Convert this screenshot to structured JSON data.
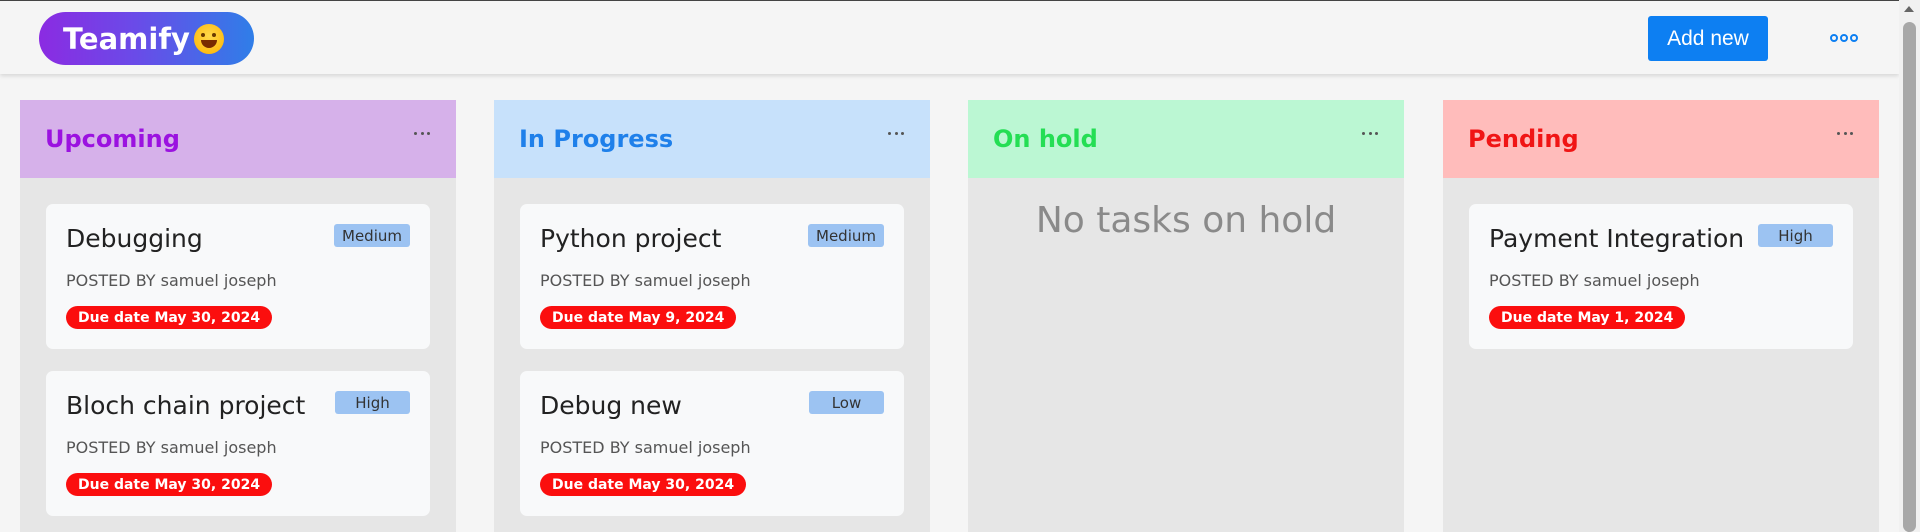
{
  "app": {
    "logo_text": "Teamify",
    "add_new_label": "Add new"
  },
  "colors": {
    "accent": "#0d7ff2",
    "upcoming": "#9b12e0",
    "in_progress": "#1f80ea",
    "on_hold": "#24de54",
    "pending": "#f01515",
    "due_badge": "#fb0e0e",
    "priority_badge": "#9cc3f2"
  },
  "columns": [
    {
      "title": "Upcoming",
      "tasks": [
        {
          "title": "Debugging",
          "priority": "Medium",
          "posted_by": "POSTED BY samuel joseph",
          "due": "Due date May 30, 2024"
        },
        {
          "title": "Bloch chain project",
          "priority": "High",
          "posted_by": "POSTED BY samuel joseph",
          "due": "Due date May 30, 2024"
        }
      ]
    },
    {
      "title": "In Progress",
      "tasks": [
        {
          "title": "Python project",
          "priority": "Medium",
          "posted_by": "POSTED BY samuel joseph",
          "due": "Due date May 9, 2024"
        },
        {
          "title": "Debug new",
          "priority": "Low",
          "posted_by": "POSTED BY samuel joseph",
          "due": "Due date May 30, 2024"
        }
      ]
    },
    {
      "title": "On hold",
      "empty_message": "No tasks on hold",
      "tasks": []
    },
    {
      "title": "Pending",
      "tasks": [
        {
          "title": "Payment Integration",
          "priority": "High",
          "posted_by": "POSTED BY samuel joseph",
          "due": "Due date May 1, 2024"
        }
      ]
    }
  ]
}
